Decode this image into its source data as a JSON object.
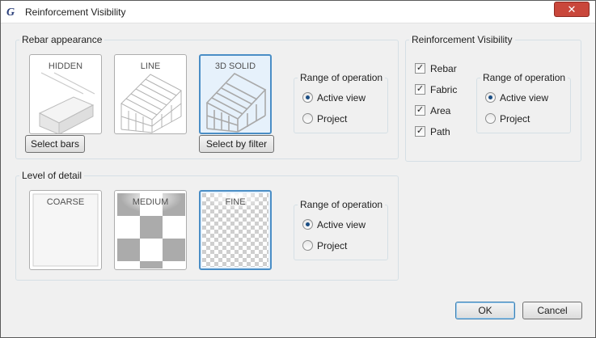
{
  "window": {
    "title": "Reinforcement Visibility",
    "close_glyph": "✕"
  },
  "rebar_appearance": {
    "legend": "Rebar appearance",
    "tiles": [
      {
        "label": "HIDDEN",
        "selected": false
      },
      {
        "label": "LINE",
        "selected": false
      },
      {
        "label": "3D SOLID",
        "selected": true
      }
    ],
    "select_bars_label": "Select bars",
    "select_by_filter_label": "Select by filter",
    "range": {
      "legend": "Range of operation",
      "active_view": "Active view",
      "project": "Project",
      "selected": "Active view"
    }
  },
  "level_of_detail": {
    "legend": "Level of detail",
    "tiles": [
      {
        "label": "COARSE",
        "selected": false
      },
      {
        "label": "MEDIUM",
        "selected": false
      },
      {
        "label": "FINE",
        "selected": true
      }
    ],
    "range": {
      "legend": "Range of operation",
      "active_view": "Active view",
      "project": "Project",
      "selected": "Active view"
    }
  },
  "reinforcement_visibility": {
    "legend": "Reinforcement Visibility",
    "checks": [
      {
        "label": "Rebar",
        "checked": true
      },
      {
        "label": "Fabric",
        "checked": true
      },
      {
        "label": "Area",
        "checked": true
      },
      {
        "label": "Path",
        "checked": true
      }
    ],
    "check_glyph": "✓",
    "range": {
      "legend": "Range of operation",
      "active_view": "Active view",
      "project": "Project",
      "selected": "Active view"
    }
  },
  "footer": {
    "ok_label": "OK",
    "cancel_label": "Cancel"
  }
}
